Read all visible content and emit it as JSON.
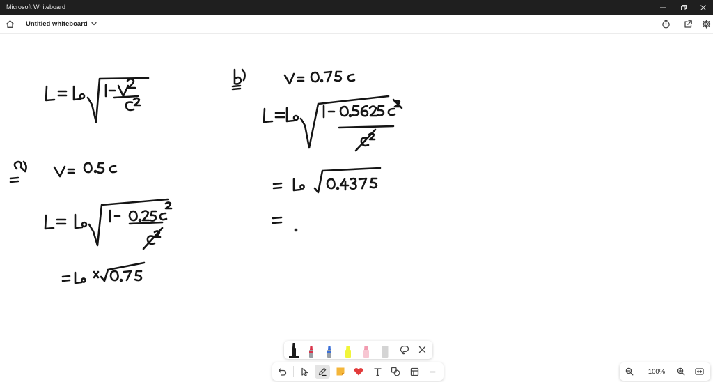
{
  "window": {
    "title": "Microsoft Whiteboard"
  },
  "header": {
    "board_title": "Untitled whiteboard"
  },
  "zoom": {
    "level": "100%"
  },
  "colors": {
    "pen_black": "#1a1a1a",
    "pen_red": "#d9344a",
    "pen_blue": "#3a6fd8",
    "highlighter_yellow": "#f1f53a",
    "highlighter_pink": "#f29bb0",
    "eraser_gray": "#b8b8b8",
    "note_yellow": "#f4b63a",
    "reaction_red": "#e23b3b"
  },
  "icons": {
    "home": "home-icon",
    "timer": "timer-icon",
    "share": "share-icon",
    "settings": "gear-icon",
    "undo": "undo-icon",
    "select": "pointer-icon",
    "pen": "pen-icon",
    "sticky": "sticky-note-icon",
    "reaction": "heart-icon",
    "text": "text-icon",
    "shapes": "shapes-icon",
    "templates": "template-icon",
    "close": "close-icon",
    "lasso": "lasso-icon"
  }
}
